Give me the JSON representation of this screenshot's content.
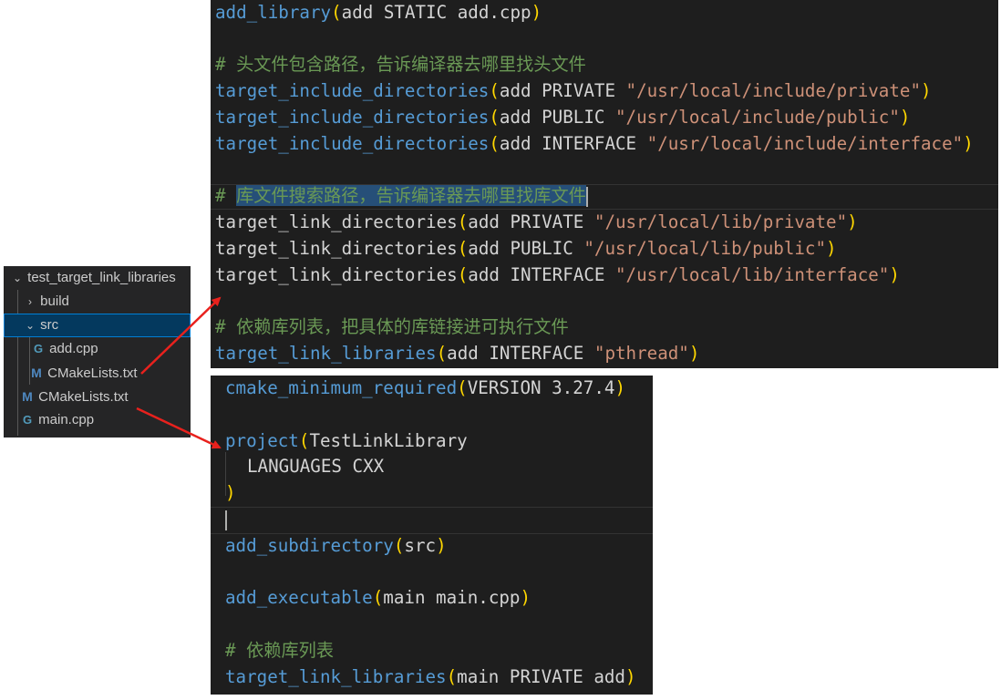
{
  "explorer": {
    "root_folder": "test_target_link_libraries",
    "items": [
      {
        "label": "build",
        "type": "folder",
        "expanded": false
      },
      {
        "label": "src",
        "type": "folder",
        "expanded": true
      },
      {
        "label": "add.cpp",
        "type": "file",
        "icon": "cpp-icon"
      },
      {
        "label": "CMakeLists.txt",
        "type": "file",
        "icon": "cmake-icon"
      },
      {
        "label": "CMakeLists.txt",
        "type": "file",
        "icon": "cmake-icon"
      },
      {
        "label": "main.cpp",
        "type": "file",
        "icon": "cpp-icon"
      }
    ],
    "cpp_icon_glyph": "G",
    "cmake_icon_glyph": "M"
  },
  "src_cmakelists": {
    "line1": {
      "fn": "add_library",
      "args": "add STATIC add.cpp"
    },
    "comment1": "# 头文件包含路径，告诉编译器去哪里找头文件",
    "include_fn": "target_include_directories",
    "include_lines": [
      {
        "args": "add PRIVATE ",
        "path": "\"/usr/local/include/private\""
      },
      {
        "args": "add PUBLIC ",
        "path": "\"/usr/local/include/public\""
      },
      {
        "args": "add INTERFACE ",
        "path": "\"/usr/local/include/interface\""
      }
    ],
    "comment2_hash": "#",
    "comment2_text": "库文件搜索路径，告诉编译器去哪里找库文件",
    "link_dir_fn": "target_link_directories",
    "link_dir_lines": [
      {
        "args": "add PRIVATE ",
        "path": "\"/usr/local/lib/private\""
      },
      {
        "args": "add PUBLIC ",
        "path": "\"/usr/local/lib/public\""
      },
      {
        "args": "add INTERFACE ",
        "path": "\"/usr/local/lib/interface\""
      }
    ],
    "comment3": "# 依赖库列表，把具体的库链接进可执行文件",
    "link_lib": {
      "fn": "target_link_libraries",
      "args": "add INTERFACE ",
      "str": "\"pthread\""
    }
  },
  "root_cmakelists": {
    "cmake_min": {
      "fn": "cmake_minimum_required",
      "args": "VERSION 3.27.4"
    },
    "project": {
      "fn": "project",
      "name": "TestLinkLibrary",
      "languages": "LANGUAGES CXX"
    },
    "add_subdir": {
      "fn": "add_subdirectory",
      "args": "src"
    },
    "add_exec": {
      "fn": "add_executable",
      "args": "main main.cpp"
    },
    "comment": "# 依赖库列表",
    "link_lib": {
      "fn": "target_link_libraries",
      "args": "main PRIVATE add"
    }
  },
  "colors": {
    "keyword": "#569cd6",
    "bracket": "#ffd700",
    "string": "#ce9178",
    "comment": "#6a9955",
    "arrow": "#e8211d"
  }
}
